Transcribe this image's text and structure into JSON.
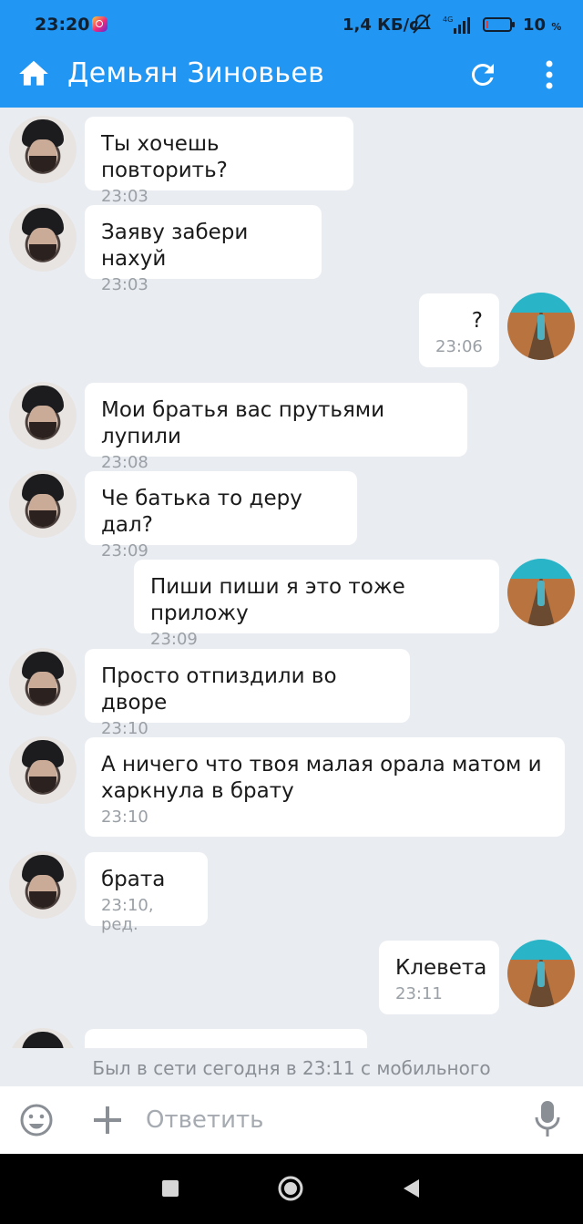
{
  "status_bar": {
    "time": "23:20",
    "network_speed": "1,4 КБ/с",
    "network_type": "4G",
    "battery_percent": "10",
    "battery_unit": "%",
    "battery_level": 0.1,
    "battery_color": "#e53935"
  },
  "header": {
    "title": "Демьян Зиновьев",
    "color": "#2196f3",
    "icons": [
      "home-icon",
      "refresh-icon",
      "more-vert-icon"
    ]
  },
  "messages": [
    {
      "dir": "in",
      "text": "Ты хочешь повторить?",
      "time": "23:03"
    },
    {
      "dir": "in",
      "text": "Заяву забери нахуй",
      "time": "23:03"
    },
    {
      "dir": "out",
      "text": "?",
      "time": "23:06"
    },
    {
      "dir": "in",
      "text": "Мои братья вас прутьями лупили",
      "time": "23:08"
    },
    {
      "dir": "in",
      "text": "Че батька то деру дал?",
      "time": "23:09"
    },
    {
      "dir": "out",
      "text": "Пиши пиши я это тоже приложу",
      "time": "23:09"
    },
    {
      "dir": "in",
      "text": "Просто отпиздили во дворе",
      "time": "23:10"
    },
    {
      "dir": "in",
      "text": "А ничего что твоя малая орала матом и\nхаркнула в брату",
      "time": "23:10"
    },
    {
      "dir": "in",
      "text": "брата",
      "time": "23:10, ред."
    },
    {
      "dir": "out",
      "text": "Клевета",
      "time": "23:11"
    }
  ],
  "last_seen": "Был в сети сегодня в 23:11 с мобильного",
  "composer": {
    "placeholder": "Ответить",
    "icons": [
      "emoji-icon",
      "plus-icon",
      "mic-icon"
    ]
  },
  "nav_bar": {
    "icons": [
      "recents-square-icon",
      "home-circle-icon",
      "back-triangle-icon"
    ]
  }
}
